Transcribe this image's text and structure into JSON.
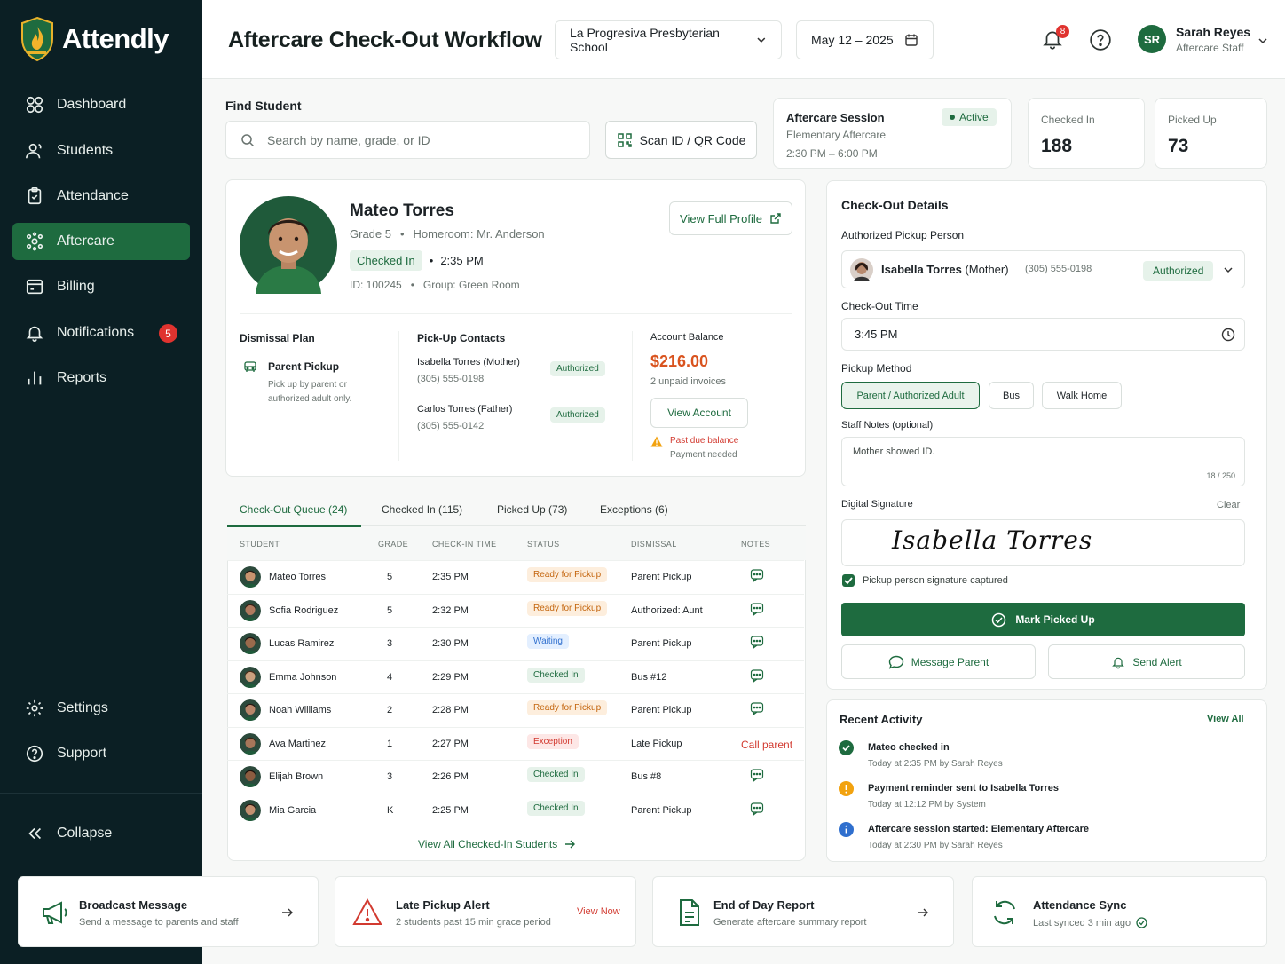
{
  "app": {
    "name": "Attendly"
  },
  "sidebar": {
    "items": [
      {
        "label": "Dashboard"
      },
      {
        "label": "Students"
      },
      {
        "label": "Attendance"
      },
      {
        "label": "Aftercare"
      },
      {
        "label": "Billing"
      },
      {
        "label": "Notifications",
        "badge": "5"
      },
      {
        "label": "Reports"
      }
    ],
    "bottom": [
      {
        "label": "Settings"
      },
      {
        "label": "Support"
      }
    ],
    "collapse": "Collapse"
  },
  "header": {
    "title": "Aftercare Check-Out Workflow",
    "school": "La Progresiva Presbyterian School",
    "date": "May 12 – 2025",
    "notif_count": "8",
    "user": {
      "initials": "SR",
      "name": "Sarah Reyes",
      "role": "Aftercare Staff"
    }
  },
  "find": {
    "label": "Find Student",
    "placeholder": "Search by name, grade, or ID",
    "scan": "Scan ID / QR Code"
  },
  "session": {
    "title": "Aftercare Session",
    "status": "Active",
    "program": "Elementary Aftercare",
    "hours": "2:30 PM – 6:00 PM"
  },
  "stats": [
    {
      "label": "Checked In",
      "value": "188"
    },
    {
      "label": "Picked Up",
      "value": "73"
    }
  ],
  "student": {
    "name": "Mateo Torres",
    "grade": "Grade 5",
    "sep": "•",
    "homeroom": "Homeroom: Mr. Anderson",
    "status": "Checked In",
    "time": "2:35 PM",
    "id": "ID: 100245",
    "group": "Group: Green Room",
    "view_profile": "View Full Profile",
    "dismissal": {
      "title": "Dismissal Plan",
      "plan": "Parent Pickup",
      "desc1": "Pick up by parent or",
      "desc2": "authorized adult only."
    },
    "contacts": {
      "title": "Pick-Up Contacts",
      "list": [
        {
          "name": "Isabella Torres (Mother)",
          "phone": "(305) 555-0198",
          "status": "Authorized"
        },
        {
          "name": "Carlos Torres (Father)",
          "phone": "(305) 555-0142",
          "status": "Authorized"
        }
      ]
    },
    "balance": {
      "title": "Account Balance",
      "amount": "$216.00",
      "invoices": "2 unpaid invoices",
      "button": "View Account",
      "warning": "Past due balance",
      "note": "Payment needed"
    }
  },
  "tabs": [
    {
      "label": "Check-Out Queue (24)"
    },
    {
      "label": "Checked In (115)"
    },
    {
      "label": "Picked Up (73)"
    },
    {
      "label": "Exceptions (6)"
    }
  ],
  "table": {
    "headers": [
      "STUDENT",
      "GRADE",
      "CHECK-IN TIME",
      "STATUS",
      "DISMISSAL",
      "NOTES"
    ],
    "rows": [
      {
        "name": "Mateo Torres",
        "grade": "5",
        "time": "2:35 PM",
        "status": "Ready for Pickup",
        "kind": "ready",
        "dismissal": "Parent Pickup",
        "note": ""
      },
      {
        "name": "Sofia Rodriguez",
        "grade": "5",
        "time": "2:32 PM",
        "status": "Ready for Pickup",
        "kind": "ready",
        "dismissal": "Authorized: Aunt",
        "note": ""
      },
      {
        "name": "Lucas Ramirez",
        "grade": "3",
        "time": "2:30 PM",
        "status": "Waiting",
        "kind": "wait",
        "dismissal": "Parent Pickup",
        "note": ""
      },
      {
        "name": "Emma Johnson",
        "grade": "4",
        "time": "2:29 PM",
        "status": "Checked In",
        "kind": "chk",
        "dismissal": "Bus #12",
        "note": ""
      },
      {
        "name": "Noah Williams",
        "grade": "2",
        "time": "2:28 PM",
        "status": "Ready for Pickup",
        "kind": "ready",
        "dismissal": "Parent Pickup",
        "note": ""
      },
      {
        "name": "Ava Martinez",
        "grade": "1",
        "time": "2:27 PM",
        "status": "Exception",
        "kind": "exc",
        "dismissal": "Late Pickup",
        "note": "Call parent"
      },
      {
        "name": "Elijah Brown",
        "grade": "3",
        "time": "2:26 PM",
        "status": "Checked In",
        "kind": "chk",
        "dismissal": "Bus #8",
        "note": ""
      },
      {
        "name": "Mia Garcia",
        "grade": "K",
        "time": "2:25 PM",
        "status": "Checked In",
        "kind": "chk",
        "dismissal": "Parent Pickup",
        "note": ""
      }
    ],
    "view_all": "View All Checked-In Students"
  },
  "checkout": {
    "title": "Check-Out Details",
    "pickup_label": "Authorized Pickup Person",
    "pickup_name": "Isabella Torres",
    "pickup_rel": "(Mother)",
    "pickup_phone": "(305) 555-0198",
    "pickup_status": "Authorized",
    "time_label": "Check-Out Time",
    "time_value": "3:45 PM",
    "method_label": "Pickup Method",
    "methods": [
      "Parent / Authorized Adult",
      "Bus",
      "Walk Home"
    ],
    "notes_label": "Staff Notes (optional)",
    "notes_value": "Mother showed ID.",
    "notes_count": "18 / 250",
    "sig_label": "Digital Signature",
    "sig_clear": "Clear",
    "signature": "Isabella Torres",
    "sig_captured": "Pickup person signature captured",
    "mark": "Mark Picked Up",
    "message": "Message Parent",
    "alert": "Send Alert"
  },
  "activity": {
    "title": "Recent Activity",
    "view_all": "View All",
    "items": [
      {
        "title": "Mateo checked in",
        "meta": "Today at 2:35 PM by Sarah Reyes",
        "color": "#1e6b3f"
      },
      {
        "title": "Payment reminder sent to Isabella Torres",
        "meta": "Today at 12:12 PM by System",
        "color": "#f2a20f"
      },
      {
        "title": "Aftercare session started: Elementary Aftercare",
        "meta": "Today at 2:30 PM by Sarah Reyes",
        "color": "#2f6fce"
      }
    ]
  },
  "bottom": [
    {
      "title": "Broadcast Message",
      "desc": "Send a message to parents and staff"
    },
    {
      "title": "Late Pickup Alert",
      "desc": "2 students past 15 min grace period",
      "action": "View Now"
    },
    {
      "title": "End of Day Report",
      "desc": "Generate aftercare summary report"
    },
    {
      "title": "Attendance Sync",
      "desc": "Last synced 3 min ago"
    }
  ],
  "colors": {
    "brand": "#1e6b3f",
    "sidebar": "#0b1f24",
    "danger": "#d23a30",
    "warning": "#f2a20f"
  }
}
